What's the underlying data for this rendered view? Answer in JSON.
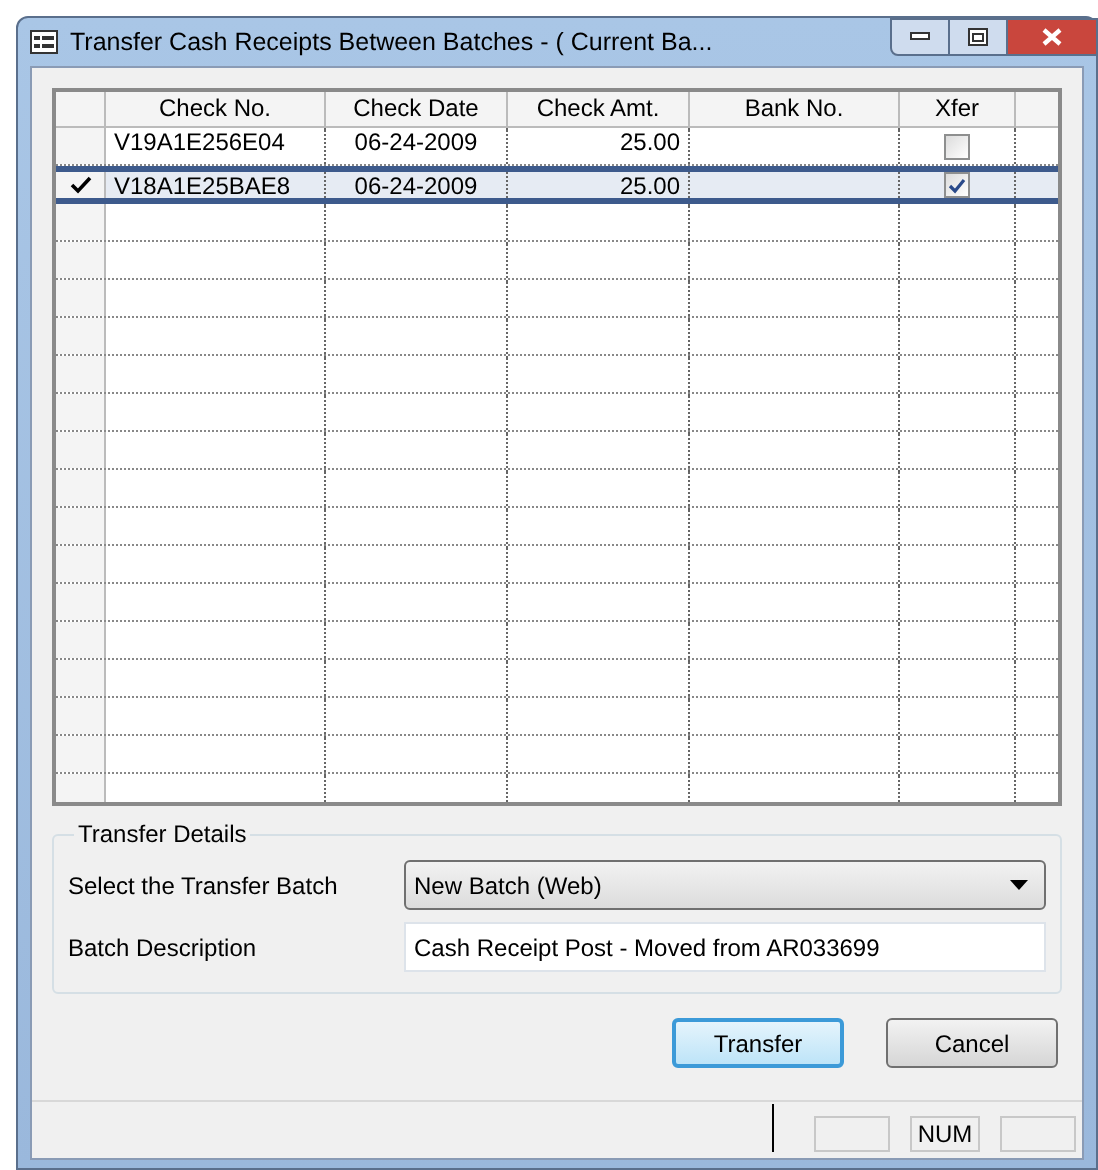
{
  "window": {
    "title": "Transfer Cash Receipts Between Batches - ( Current Ba..."
  },
  "table": {
    "columns": [
      "Check No.",
      "Check Date",
      "Check Amt.",
      "Bank No.",
      "Xfer"
    ],
    "rows": [
      {
        "check_no": "V19A1E256E04",
        "check_date": "06-24-2009",
        "check_amt": "25.00",
        "xfer": false,
        "selected": false
      },
      {
        "check_no": "V18A1E25BAE8",
        "check_date": "06-24-2009",
        "check_amt": "25.00",
        "xfer": true,
        "selected": true
      }
    ]
  },
  "transfer_details": {
    "title": "Transfer Details",
    "batch_label": "Select the Transfer Batch",
    "batch_value": "New Batch (Web)",
    "description_label": "Batch Description",
    "description_value": "Cash Receipt Post - Moved from AR033699"
  },
  "buttons": [
    {
      "label": "Transfer",
      "default": true
    },
    {
      "label": "Cancel",
      "default": false
    }
  ],
  "status_bar": {
    "num": "NUM"
  }
}
